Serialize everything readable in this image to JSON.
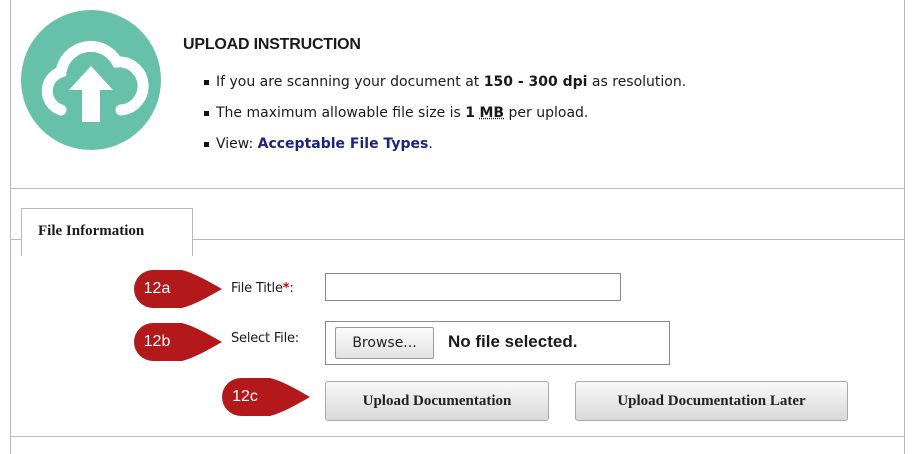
{
  "instruction": {
    "title": "UPLOAD INSTRUCTION",
    "line1_pre": "If you are scanning your document at ",
    "line1_bold": "150 - 300 dpi",
    "line1_post": " as resolution.",
    "line2_pre": "The maximum allowable file size is ",
    "line2_num": "1",
    "line2_unit": "MB",
    "line2_post": " per upload.",
    "line3_pre": "View: ",
    "line3_link": "Acceptable File Types",
    "line3_post": "."
  },
  "tab": {
    "label": "File Information"
  },
  "form": {
    "title_label": "File Title",
    "required_mark": "*",
    "title_colon": ":",
    "title_value": "",
    "file_label": "Select File:",
    "browse_label": "Browse...",
    "file_status": "No file selected."
  },
  "buttons": {
    "upload": "Upload Documentation",
    "upload_later": "Upload Documentation Later"
  },
  "markers": {
    "a": "12a",
    "b": "12b",
    "c": "12c"
  },
  "colors": {
    "logo": "#67c1a9",
    "marker": "#b3181b",
    "link": "#1a237e",
    "required": "#cc0000"
  },
  "icons": {
    "logo": "cloud-upload-icon"
  }
}
